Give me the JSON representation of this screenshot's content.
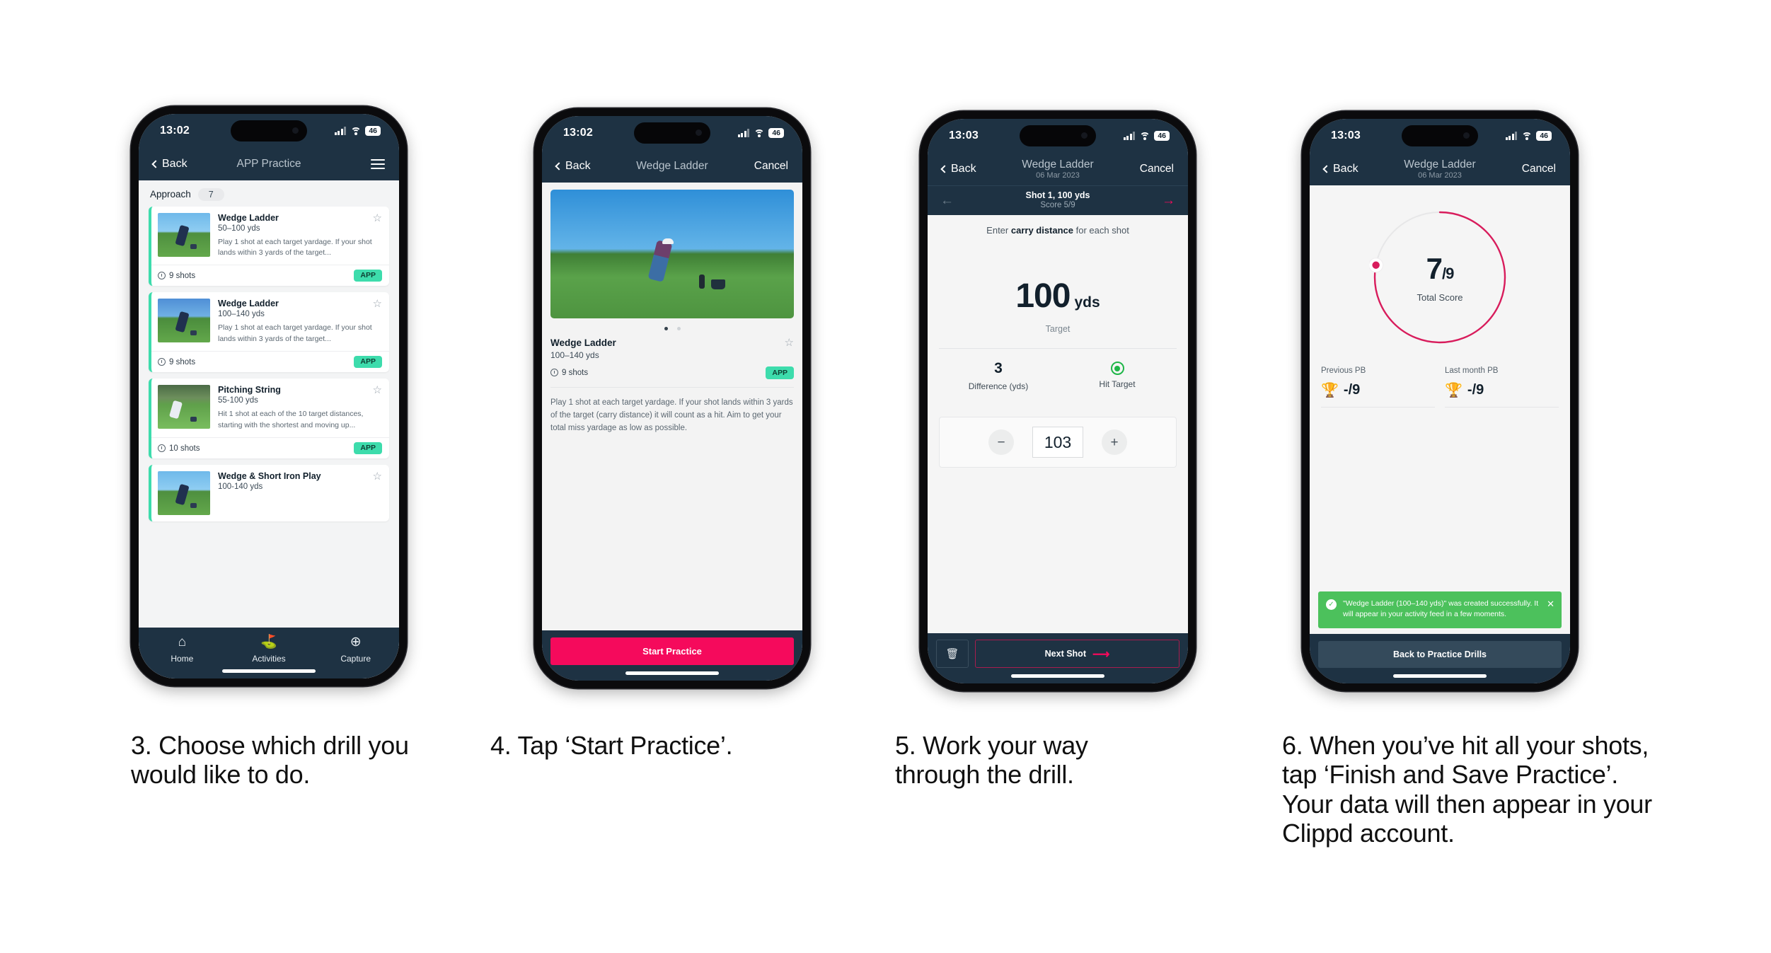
{
  "phone1": {
    "status": {
      "time": "13:02",
      "battery": "46",
      "signal_icon": "cellular-bars-icon",
      "wifi_icon": "wifi-icon"
    },
    "nav": {
      "back": "Back",
      "title": "APP Practice",
      "menu_icon": "hamburger-menu-icon"
    },
    "category": {
      "name": "Approach",
      "count": "7"
    },
    "drills": [
      {
        "title": "Wedge Ladder",
        "range": "50–100 yds",
        "desc": "Play 1 shot at each target yardage. If your shot lands within 3 yards of the target...",
        "shots": "9 shots",
        "tag": "APP",
        "star_icon": "star-outline-icon"
      },
      {
        "title": "Wedge Ladder",
        "range": "100–140 yds",
        "desc": "Play 1 shot at each target yardage. If your shot lands within 3 yards of the target...",
        "shots": "9 shots",
        "tag": "APP",
        "star_icon": "star-outline-icon"
      },
      {
        "title": "Pitching String",
        "range": "55-100 yds",
        "desc": "Hit 1 shot at each of the 10 target distances, starting with the shortest and moving up...",
        "shots": "10 shots",
        "tag": "APP",
        "star_icon": "star-outline-icon"
      },
      {
        "title": "Wedge & Short Iron Play",
        "range": "100-140 yds",
        "desc": "",
        "shots": "",
        "tag": "",
        "star_icon": "star-outline-icon"
      }
    ],
    "tabs": [
      {
        "label": "Home",
        "icon": "home-icon"
      },
      {
        "label": "Activities",
        "icon": "golf-flag-icon"
      },
      {
        "label": "Capture",
        "icon": "plus-circle-icon"
      }
    ]
  },
  "phone2": {
    "status": {
      "time": "13:02",
      "battery": "46"
    },
    "nav": {
      "back": "Back",
      "title": "Wedge Ladder",
      "right": "Cancel"
    },
    "carousel": {
      "dots": 2,
      "active": 0
    },
    "drill": {
      "title": "Wedge Ladder",
      "range": "100–140 yds",
      "shots": "9 shots",
      "tag": "APP",
      "star_icon": "star-outline-icon",
      "description": "Play 1 shot at each target yardage. If your shot lands within 3 yards of the target (carry distance) it will count as a hit. Aim to get your total miss yardage as low as possible."
    },
    "cta": "Start Practice"
  },
  "phone3": {
    "status": {
      "time": "13:03",
      "battery": "46"
    },
    "nav": {
      "back": "Back",
      "title": "Wedge Ladder",
      "subtitle": "06 Mar 2023",
      "right": "Cancel"
    },
    "shotbar": {
      "prev_icon": "arrow-left-icon",
      "next_icon": "arrow-right-icon",
      "title": "Shot 1, 100 yds",
      "score": "Score 5/9"
    },
    "instruction_prefix": "Enter ",
    "instruction_bold": "carry distance",
    "instruction_suffix": " for each shot",
    "target": {
      "value": "100",
      "unit": "yds",
      "label": "Target"
    },
    "stats": [
      {
        "value": "3",
        "label": "Difference (yds)"
      },
      {
        "value": "",
        "label": "Hit Target",
        "icon": "target-hit-icon"
      }
    ],
    "stepper": {
      "minus": "−",
      "value": "103",
      "plus": "+"
    },
    "footer": {
      "delete_icon": "trash-icon",
      "next": "Next Shot",
      "next_arrow_icon": "arrow-right-icon"
    }
  },
  "phone4": {
    "status": {
      "time": "13:03",
      "battery": "46"
    },
    "nav": {
      "back": "Back",
      "title": "Wedge Ladder",
      "subtitle": "06 Mar 2023",
      "right": "Cancel"
    },
    "gauge": {
      "score": "7",
      "divider": "/",
      "total": "9",
      "label": "Total Score",
      "pct": 78,
      "color": "#d81c5c"
    },
    "pbs": [
      {
        "label": "Previous PB",
        "value": "-/9",
        "icon": "trophy-icon"
      },
      {
        "label": "Last month PB",
        "value": "-/9",
        "icon": "trophy-icon"
      }
    ],
    "toast": {
      "check_icon": "check-circle-icon",
      "close_icon": "close-icon",
      "message": "\"Wedge Ladder (100–140 yds)\" was created successfully. It will appear in your activity feed in a few moments.",
      "color": "#4cc15c"
    },
    "cta": "Back to Practice Drills"
  },
  "captions": {
    "c1": "3. Choose which drill you would like to do.",
    "c2": "4. Tap ‘Start Practice’.",
    "c3": "5. Work your way through the drill.",
    "c4": "6. When you’ve hit all your shots, tap ‘Finish and Save Practice’. Your data will then appear in your Clippd account."
  },
  "theme": {
    "header": "#1e3243",
    "accent_pink": "#f50a5c",
    "accent_teal": "#3ddcac",
    "success_green": "#4cc15c",
    "page_bg": "#ffffff"
  }
}
